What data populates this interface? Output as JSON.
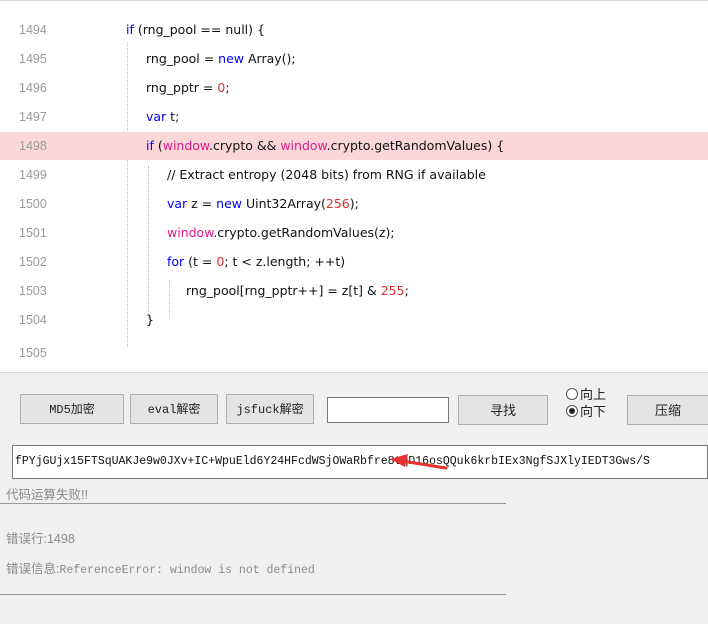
{
  "editor": {
    "lines": [
      {
        "num": "1494"
      },
      {
        "num": "1495"
      },
      {
        "num": "1496"
      },
      {
        "num": "1497"
      },
      {
        "num": "1498"
      },
      {
        "num": "1499"
      },
      {
        "num": "1500"
      },
      {
        "num": "1501"
      },
      {
        "num": "1502"
      },
      {
        "num": "1503"
      },
      {
        "num": "1504"
      },
      {
        "num": "1505"
      }
    ],
    "tokens": {
      "t_if": "if",
      "rng_pool_null": " (rng_pool == null) {",
      "rng_pool_eq": "rng_pool = ",
      "new": "new",
      "array_call": " Array();",
      "rng_pptr_eq": "rng_pptr = ",
      "zero": "0",
      "semi": ";",
      "var": "var",
      "t_semi": " t;",
      "paren_open": " (",
      "window": "window",
      "crypto_and": ".crypto && ",
      "crypto_get": ".crypto.getRandomValues) {",
      "comment": "// Extract entropy (2048 bits) from RNG if available",
      "z_eq": " z = ",
      "uint32": " Uint32Array(",
      "n256": "256",
      "close_semi": ");",
      "get_random_z": ".crypto.getRandomValues(z);",
      "for": "for",
      "t_eq": " (t = ",
      "loop_rest": "; t < z.length; ++t)",
      "pool_assign": "rng_pool[rng_pptr++] = z[t] & ",
      "n255": "255",
      "brace": "}"
    }
  },
  "toolbar": {
    "md5_label": "MD5加密",
    "eval_label": "eval解密",
    "jsfuck_label": "jsfuck解密",
    "search_value": "",
    "find_label": "寻找",
    "radio_up": "向上",
    "radio_down": "向下",
    "compress_label": "压缩"
  },
  "output": {
    "value": "fPYjGUjx15FTSqUAKJe9w0JXv+IC+WpuEld6Y24HFcdWSjOWaRbfre8tqD16osQQuk6krbIEx3NgfSJXlyIEDT3Gws/S"
  },
  "result": {
    "fail_msg": "代码运算失败!!",
    "error_line_label": "错误行:",
    "error_line_value": "1498",
    "error_info_label": "错误信息:",
    "error_info_value": "ReferenceError: window is not defined"
  },
  "colors": {
    "keyword": "#0000ff",
    "number": "#e03030",
    "global": "#e01b8a",
    "comment": "#008000",
    "highlight_row": "#fbd7d7",
    "arrow": "#e8322d"
  }
}
